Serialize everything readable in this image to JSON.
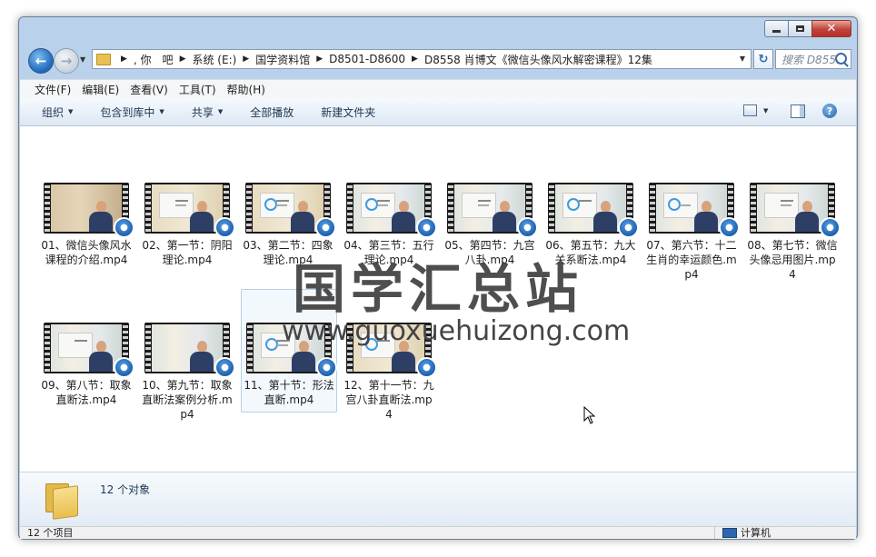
{
  "window": {
    "controls": {
      "minimize": "–",
      "maximize": "▭",
      "close": "✕"
    }
  },
  "nav": {
    "back_glyph": "←",
    "forward_glyph": "→",
    "breadcrumbs": [
      ", 你　吧",
      "系统 (E:)",
      "国学资料馆",
      "D8501-D8600",
      "D8558 肖博文《微信头像风水解密课程》12集"
    ],
    "search_placeholder": "搜索 D855..."
  },
  "menu": [
    "文件(F)",
    "编辑(E)",
    "查看(V)",
    "工具(T)",
    "帮助(H)"
  ],
  "toolbar": {
    "organize": "组织",
    "include_library": "包含到库中",
    "share": "共享",
    "play_all": "全部播放",
    "new_folder": "新建文件夹",
    "help_glyph": "?"
  },
  "files": [
    {
      "name": "01、微信头像风水课程的介绍.mp4"
    },
    {
      "name": "02、第一节：阴阳理论.mp4"
    },
    {
      "name": "03、第二节：四象理论.mp4"
    },
    {
      "name": "04、第三节：五行理论.mp4"
    },
    {
      "name": "05、第四节：九宫八卦.mp4"
    },
    {
      "name": "06、第五节：九大关系断法.mp4"
    },
    {
      "name": "07、第六节：十二生肖的幸运颜色.mp4"
    },
    {
      "name": "08、第七节：微信头像忌用图片.mp4"
    },
    {
      "name": "09、第八节：取象直断法.mp4"
    },
    {
      "name": "10、第九节：取象直断法案例分析.mp4"
    },
    {
      "name": "11、第十节：形法直断.mp4"
    },
    {
      "name": "12、第十一节：九宫八卦直断法.mp4"
    }
  ],
  "watermark": {
    "text": "国学汇总站",
    "url": "www.guoxuehuizong.com"
  },
  "details": {
    "object_count": "12 个对象"
  },
  "status": {
    "items": "12 个项目",
    "location": "计算机"
  },
  "colors": {
    "frame": "#b9d1ea",
    "accent": "#2a71c2",
    "close": "#c0433a"
  }
}
